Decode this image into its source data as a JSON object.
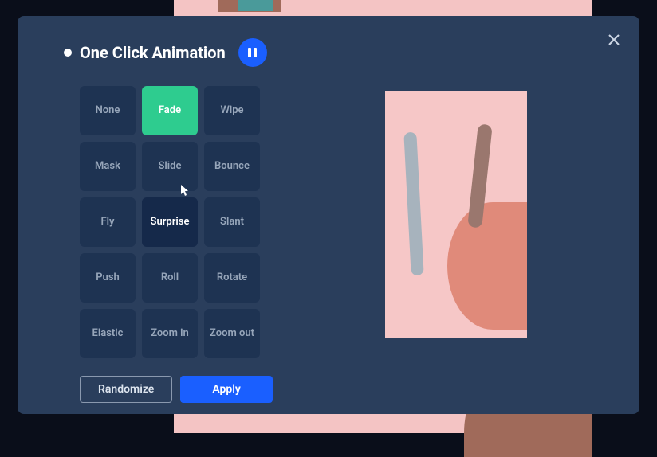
{
  "modal": {
    "title": "One Click Animation"
  },
  "animations": [
    {
      "label": "None",
      "state": ""
    },
    {
      "label": "Fade",
      "state": "selected"
    },
    {
      "label": "Wipe",
      "state": ""
    },
    {
      "label": "Mask",
      "state": ""
    },
    {
      "label": "Slide",
      "state": ""
    },
    {
      "label": "Bounce",
      "state": ""
    },
    {
      "label": "Fly",
      "state": ""
    },
    {
      "label": "Surprise",
      "state": "hover"
    },
    {
      "label": "Slant",
      "state": ""
    },
    {
      "label": "Push",
      "state": ""
    },
    {
      "label": "Roll",
      "state": ""
    },
    {
      "label": "Rotate",
      "state": ""
    },
    {
      "label": "Elastic",
      "state": ""
    },
    {
      "label": "Zoom in",
      "state": ""
    },
    {
      "label": "Zoom out",
      "state": ""
    }
  ],
  "footer": {
    "randomize": "Randomize",
    "apply": "Apply"
  }
}
